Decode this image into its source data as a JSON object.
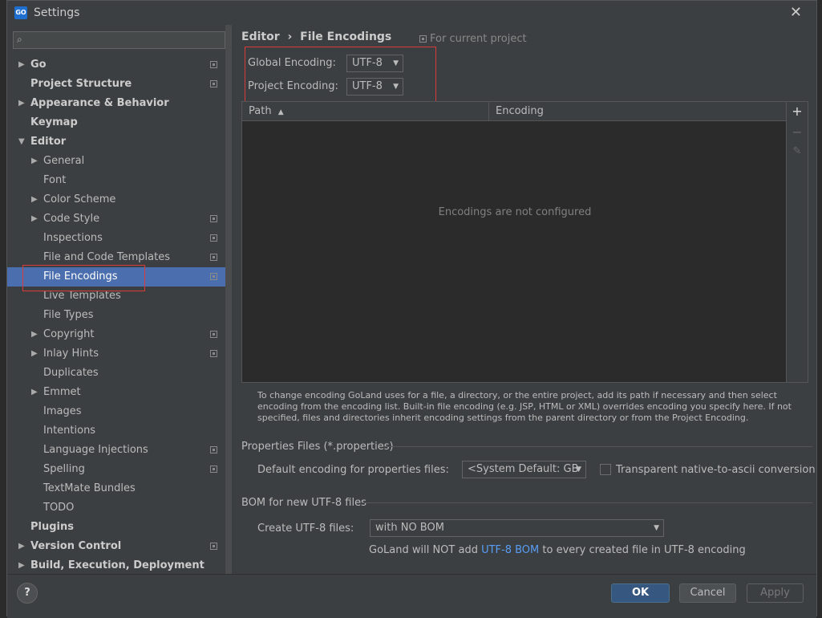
{
  "window": {
    "title": "Settings",
    "icon": "GO",
    "close_label": "✕"
  },
  "search": {
    "placeholder": ""
  },
  "tree": [
    {
      "label": "Go",
      "level": 0,
      "arrow": true,
      "bold": true,
      "proj": true
    },
    {
      "label": "Project Structure",
      "level": 0,
      "arrow": false,
      "bold": true,
      "proj": true
    },
    {
      "label": "Appearance & Behavior",
      "level": 0,
      "arrow": true,
      "bold": true,
      "proj": false
    },
    {
      "label": "Keymap",
      "level": 0,
      "arrow": false,
      "bold": true,
      "proj": false
    },
    {
      "label": "Editor",
      "level": 0,
      "arrow": true,
      "expanded": true,
      "bold": true,
      "proj": false
    },
    {
      "label": "General",
      "level": 1,
      "arrow": true,
      "proj": false
    },
    {
      "label": "Font",
      "level": 1,
      "arrow": false,
      "proj": false
    },
    {
      "label": "Color Scheme",
      "level": 1,
      "arrow": true,
      "proj": false
    },
    {
      "label": "Code Style",
      "level": 1,
      "arrow": true,
      "proj": true
    },
    {
      "label": "Inspections",
      "level": 1,
      "arrow": false,
      "proj": true
    },
    {
      "label": "File and Code Templates",
      "level": 1,
      "arrow": false,
      "proj": true
    },
    {
      "label": "File Encodings",
      "level": 1,
      "arrow": false,
      "proj": true,
      "selected": true
    },
    {
      "label": "Live Templates",
      "level": 1,
      "arrow": false,
      "proj": false
    },
    {
      "label": "File Types",
      "level": 1,
      "arrow": false,
      "proj": false
    },
    {
      "label": "Copyright",
      "level": 1,
      "arrow": true,
      "proj": true
    },
    {
      "label": "Inlay Hints",
      "level": 1,
      "arrow": true,
      "proj": true
    },
    {
      "label": "Duplicates",
      "level": 1,
      "arrow": false,
      "proj": false
    },
    {
      "label": "Emmet",
      "level": 1,
      "arrow": true,
      "proj": false
    },
    {
      "label": "Images",
      "level": 1,
      "arrow": false,
      "proj": false
    },
    {
      "label": "Intentions",
      "level": 1,
      "arrow": false,
      "proj": false
    },
    {
      "label": "Language Injections",
      "level": 1,
      "arrow": false,
      "proj": true
    },
    {
      "label": "Spelling",
      "level": 1,
      "arrow": false,
      "proj": true
    },
    {
      "label": "TextMate Bundles",
      "level": 1,
      "arrow": false,
      "proj": false
    },
    {
      "label": "TODO",
      "level": 1,
      "arrow": false,
      "proj": false
    },
    {
      "label": "Plugins",
      "level": 0,
      "arrow": false,
      "bold": true,
      "proj": false
    },
    {
      "label": "Version Control",
      "level": 0,
      "arrow": true,
      "bold": true,
      "proj": true
    },
    {
      "label": "Build, Execution, Deployment",
      "level": 0,
      "arrow": true,
      "bold": true,
      "proj": false
    }
  ],
  "breadcrumb": {
    "parent": "Editor",
    "sep": "›",
    "current": "File Encodings"
  },
  "for_current_project": "For current project",
  "global_encoding": {
    "label": "Global Encoding:",
    "value": "UTF-8"
  },
  "project_encoding": {
    "label": "Project Encoding:",
    "value": "UTF-8"
  },
  "table": {
    "col_path": "Path",
    "sort_arrow": "▲",
    "col_encoding": "Encoding",
    "empty": "Encodings are not configured"
  },
  "table_toolbar": {
    "add": "+",
    "remove": "−",
    "edit": "✎"
  },
  "help_text": "To change encoding GoLand uses for a file, a directory, or the entire project, add its path if necessary and then select encoding from the encoding list. Built-in file encoding (e.g. JSP, HTML or XML) overrides encoding you specify here. If not specified, files and directories inherit encoding settings from the parent directory or from the Project Encoding.",
  "properties": {
    "section": "Properties Files (*.properties)",
    "default_label": "Default encoding for properties files:",
    "default_value": "<System Default: GB",
    "transparent_label": "Transparent native-to-ascii conversion"
  },
  "bom": {
    "section": "BOM for new UTF-8 files",
    "create_label": "Create UTF-8 files:",
    "create_value": "with NO BOM",
    "note_pre": "GoLand will NOT add ",
    "note_link": "UTF-8 BOM",
    "note_post": " to every created file in UTF-8 encoding"
  },
  "footer": {
    "help": "?",
    "ok": "OK",
    "cancel": "Cancel",
    "apply": "Apply"
  },
  "colors": {
    "selection": "#4b6eaf",
    "accent": "#365880",
    "link": "#589df6",
    "highlight_box": "#d93a3a"
  }
}
